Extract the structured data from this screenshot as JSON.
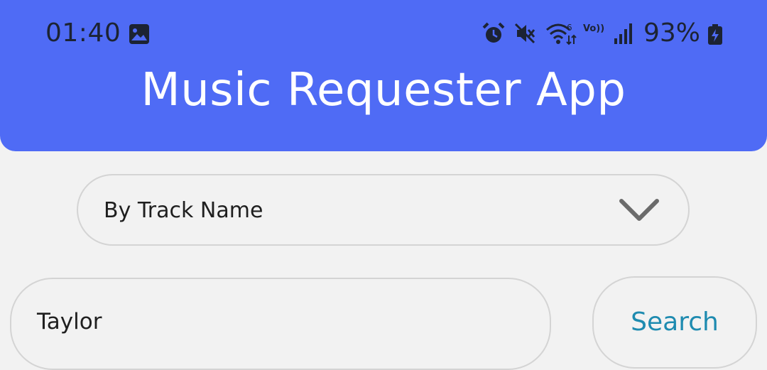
{
  "status_bar": {
    "time": "01:40",
    "network_label": "Vo)) LTE",
    "battery_percent": "93%",
    "icons": [
      "gallery-icon",
      "alarm-icon",
      "mute-icon",
      "wifi-icon",
      "volte-icon",
      "signal-icon",
      "battery-charging-icon"
    ]
  },
  "header": {
    "title": "Music Requester App",
    "background": "#4f6bf5"
  },
  "filter": {
    "selected": "By Track Name"
  },
  "search": {
    "value": "Taylor",
    "button_label": "Search",
    "button_color": "#1e8bb0"
  }
}
